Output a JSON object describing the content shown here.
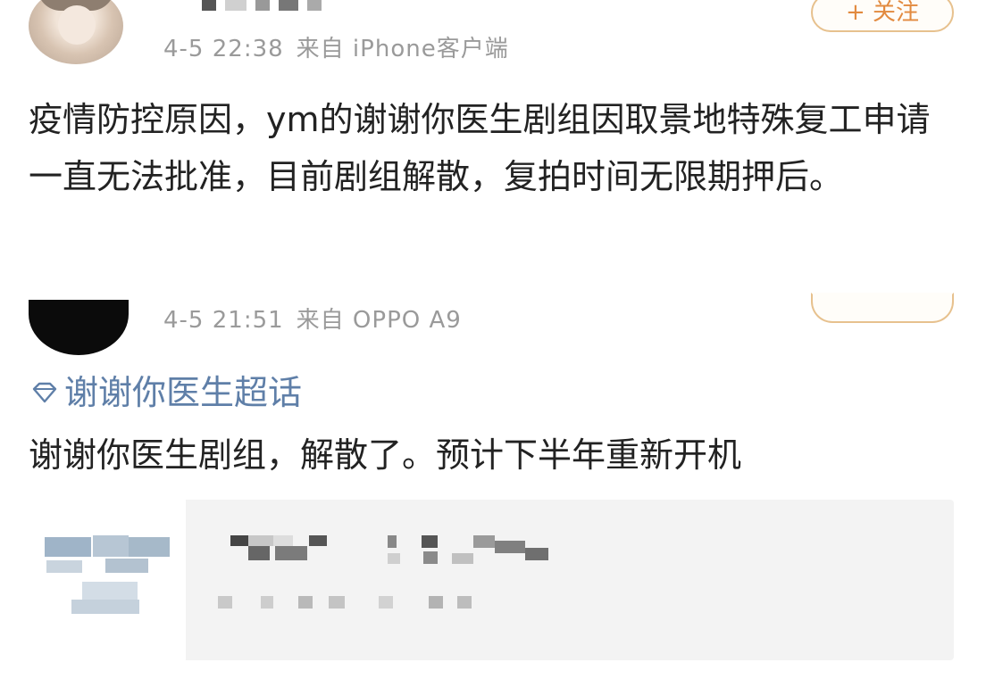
{
  "posts": [
    {
      "meta": {
        "time": "4-5 22:38",
        "source": "来自 iPhone客户端"
      },
      "follow_label": "+ 关注",
      "content": "疫情防控原因，ym的谢谢你医生剧组因取景地特殊复工申请一直无法批准，目前剧组解散，复拍时间无限期押后。"
    },
    {
      "meta": {
        "time": "4-5 21:51",
        "source": "来自 OPPO A9"
      },
      "follow_label": "",
      "topic": "谢谢你医生超话",
      "content": "谢谢你医生剧组，解散了。预计下半年重新开机"
    }
  ],
  "colors": {
    "meta_text": "#9a9a9a",
    "topic_link": "#5f7fa8",
    "follow_border": "#e7c18e",
    "follow_text": "#e28a3f",
    "card_bg": "#f3f3f3"
  },
  "icons": {
    "topic": "diamond-topic-icon"
  }
}
